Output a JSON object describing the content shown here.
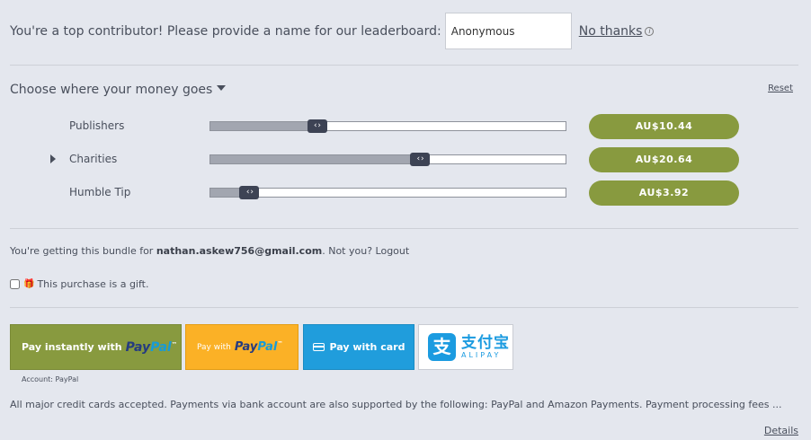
{
  "contributor": {
    "prompt": "You're a top contributor! Please provide a name for our leaderboard:",
    "name_value": "Anonymous",
    "no_thanks": "No thanks",
    "info_icon": "info-icon"
  },
  "allocation": {
    "heading": "Choose where your money goes",
    "reset": "Reset",
    "handle_glyph": "‹ ›",
    "rows": [
      {
        "label": "Publishers",
        "amount": "AU$10.44",
        "level_pct": 30
      },
      {
        "label": "Charities",
        "amount": "AU$20.64",
        "level_pct": 59
      },
      {
        "label": "Humble Tip",
        "amount": "AU$3.92",
        "level_pct": 11
      }
    ]
  },
  "account": {
    "prefix": "You're getting this bundle for ",
    "email": "nathan.askew756@gmail.com",
    "suffix": ". Not you? Logout",
    "gift_label": "This purchase is a gift.",
    "gift_checked": false
  },
  "payment": {
    "instant_label": "Pay instantly with",
    "paypal_p1": "Pay",
    "paypal_p2": "Pal",
    "tm": "™",
    "paypal_plain_label": "Pay with",
    "card_label": "Pay with card",
    "alipay_cn": "支付宝",
    "alipay_en": "ALIPAY",
    "alipay_mark": "支",
    "account_label": "Account: PayPal"
  },
  "footer": {
    "notice": "All major credit cards accepted. Payments via bank account are also supported by the following: PayPal and Amazon Payments. Payment processing fees ...",
    "details": "Details"
  },
  "colors": {
    "background": "#e4e7ee",
    "amount_pill": "#889a3f",
    "paypal_yellow": "#fbb126",
    "card_blue": "#209ddc"
  }
}
